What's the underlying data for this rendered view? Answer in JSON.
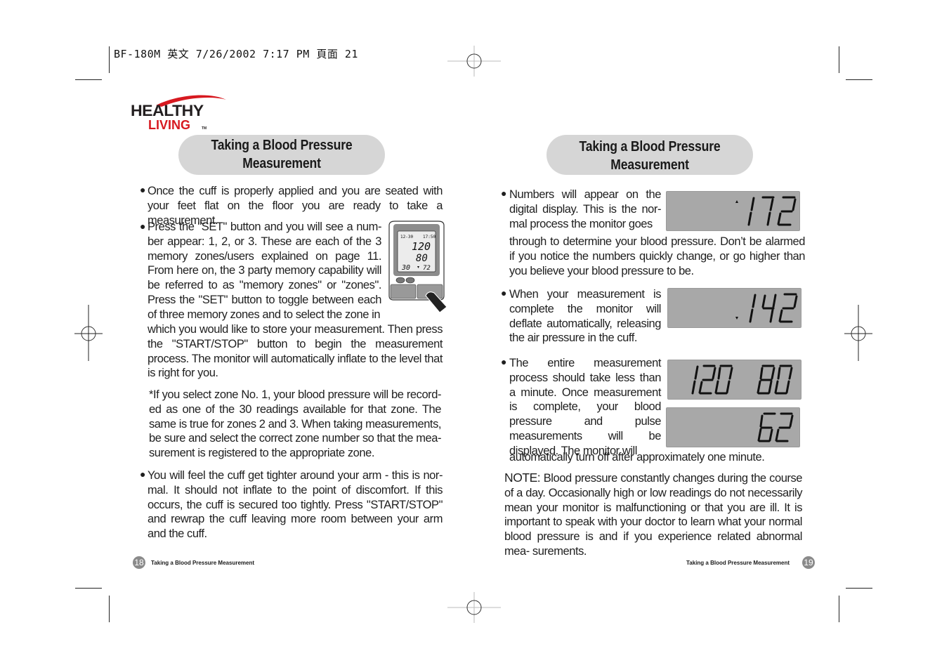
{
  "slug": {
    "text": "BF-180M 英文  7/26/2002  7:17 PM  頁面 21"
  },
  "brand": {
    "line1": "HEALTHY",
    "line2": "LIVING",
    "tm": "TM",
    "red": "#d71920",
    "black": "#231f20"
  },
  "left_page": {
    "title_line1": "Taking a Blood Pressure",
    "title_line2": "Measurement",
    "bullets": [
      "Once the cuff is properly applied and you are seated with your feet flat on the floor you are ready to take a measurement.",
      "Press the \"SET\" button and you will see a num- ber appear: 1, 2, or 3. These are each of the 3 memory zones/users explained on page 11. From here on, the 3 party memory capability will be referred to as \"memory zones\" or \"zones\". Press the \"SET\" button to toggle between each of three memory zones and to select the zone in",
      "which you would like to store your measurement. Then press the \"START/STOP\" button to begin the measurement process. The monitor will automatically inflate to the level that is right for you.",
      "*If you select zone No. 1, your blood pressure will be record- ed as one of the 30 readings available for that zone. The same is true for zones 2 and 3. When taking measurements, be sure and select the correct zone number so that the mea- surement is registered to the appropriate zone.",
      "You will feel the cuff get tighter around your arm - this is nor- mal. It should not inflate to the point of discomfort. If this occurs, the cuff is secured too tightly. Press \"START/STOP\" and rewrap the cuff leaving more room between your arm and the cuff."
    ],
    "device_illustration": {
      "date": "12-30",
      "time": "17:50",
      "systolic": "120",
      "diastolic": "80",
      "memory": "30",
      "pulse": "72"
    },
    "footer_label": "Taking a Blood Pressure Measurement",
    "page_number": "18"
  },
  "right_page": {
    "title_line1": "Taking a Blood Pressure",
    "title_line2": "Measurement",
    "bullet1_wrapped": "Numbers will appear on the digital display. This is the nor- mal process the monitor goes",
    "bullet1_rest": "through to determine your blood pressure. Don’t be alarmed if you notice the numbers quickly change, or go higher than you believe your blood pressure to be.",
    "bullet2": "When your measurement is complete the monitor will deflate automatically, releasing the air pressure in the cuff.",
    "bullet3_wrapped": "The entire measurement process should take less than a minute. Once measurement is complete, your blood pressure and pulse measurements will be displayed. The monitor will",
    "bullet3_rest": "automatically turn off after approximately one minute.",
    "note_label": "NOTE:",
    "note_text": " Blood pressure constantly changes during the course of a day. Occasionally high or low readings do not necessarily mean your monitor is malfunctioning or that you are ill. It is important to speak with your doctor to learn what your normal blood pressure is and if you experience related abnormal mea- surements.",
    "lcd_displays": [
      {
        "reading": "172",
        "indicator": "up-arrow"
      },
      {
        "reading": "142",
        "indicator": "down-arrow"
      },
      {
        "reading": "120  80",
        "indicator": "none"
      },
      {
        "reading": "62",
        "indicator": "none"
      }
    ],
    "footer_label": "Taking a Blood Pressure Measurement",
    "page_number": "19"
  }
}
